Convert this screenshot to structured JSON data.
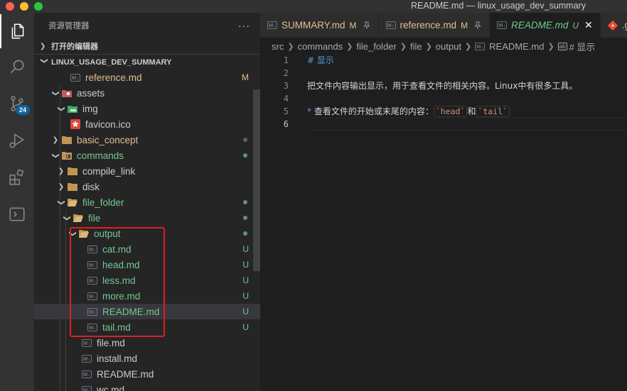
{
  "window": {
    "title": "README.md — linux_usage_dev_summary"
  },
  "activity_bar": {
    "scm_badge": "24"
  },
  "sidebar": {
    "header": "资源管理器",
    "more": "···",
    "open_editors": "打开的编辑器",
    "workspace": "LINUX_USAGE_DEV_SUMMARY",
    "rows": [
      {
        "label": "reference.md",
        "status": "M"
      },
      {
        "label": "assets"
      },
      {
        "label": "img"
      },
      {
        "label": "favicon.ico"
      },
      {
        "label": "basic_concept"
      },
      {
        "label": "commands"
      },
      {
        "label": "compile_link"
      },
      {
        "label": "disk"
      },
      {
        "label": "file_folder"
      },
      {
        "label": "file"
      },
      {
        "label": "output"
      },
      {
        "label": "cat.md",
        "status": "U"
      },
      {
        "label": "head.md",
        "status": "U"
      },
      {
        "label": "less.md",
        "status": "U"
      },
      {
        "label": "more.md",
        "status": "U"
      },
      {
        "label": "README.md",
        "status": "U"
      },
      {
        "label": "tail.md",
        "status": "U"
      },
      {
        "label": "file.md"
      },
      {
        "label": "install.md"
      },
      {
        "label": "README.md"
      },
      {
        "label": "wc.md"
      }
    ]
  },
  "tabs": [
    {
      "label": "SUMMARY.md",
      "mark": "M"
    },
    {
      "label": "reference.md",
      "mark": "M"
    },
    {
      "label": "README.md",
      "mark": "U"
    },
    {
      "label": ".g"
    }
  ],
  "breadcrumb": [
    "src",
    "commands",
    "file_folder",
    "file",
    "output",
    "README.md",
    "# 显示"
  ],
  "editor": {
    "line_numbers": [
      "1",
      "2",
      "3",
      "4",
      "5",
      "6"
    ],
    "line1": "# 显示",
    "line3": "把文件内容输出显示，用于查看文件的相关内容。Linux中有很多工具。",
    "line5_bullet": "*",
    "line5_text": " 查看文件的开始或末尾的内容：",
    "line5_code1": "`head`",
    "line5_and": "和",
    "line5_code2": "`tail`"
  },
  "colors": {
    "modified": "#e2c08d",
    "untracked": "#73c991",
    "highlight_box": "#e01e1e",
    "accent": "#0e639c"
  }
}
